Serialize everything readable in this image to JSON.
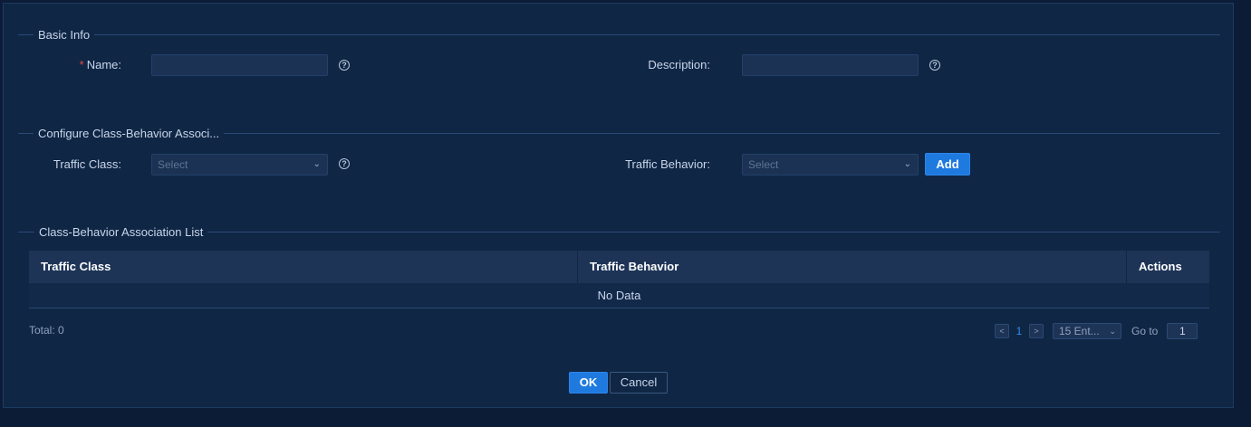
{
  "sections": {
    "basic_info": "Basic Info",
    "configure": "Configure Class-Behavior Associ...",
    "list": "Class-Behavior Association List"
  },
  "basic": {
    "required_mark": "*",
    "name_label": "Name:",
    "name_value": "",
    "description_label": "Description:",
    "description_value": ""
  },
  "configure": {
    "traffic_class_label": "Traffic Class:",
    "traffic_class_placeholder": "Select",
    "traffic_behavior_label": "Traffic Behavior:",
    "traffic_behavior_placeholder": "Select",
    "add_label": "Add"
  },
  "table": {
    "columns": [
      "Traffic Class",
      "Traffic Behavior",
      "Actions"
    ],
    "empty_text": "No Data"
  },
  "pagination": {
    "total": "Total: 0",
    "prev": "<",
    "current_page": "1",
    "next": ">",
    "page_size": "15 Ent...",
    "goto_label": "Go to",
    "goto_value": "1"
  },
  "footer": {
    "ok_label": "OK",
    "cancel_label": "Cancel"
  },
  "icons": {
    "help": "?",
    "chevron": "⌄"
  },
  "colors": {
    "background": "#0c1c36",
    "panel": "#0f2645",
    "primary": "#1f7ae0",
    "required": "#e04a4a",
    "page_active": "#2d8cf0"
  }
}
